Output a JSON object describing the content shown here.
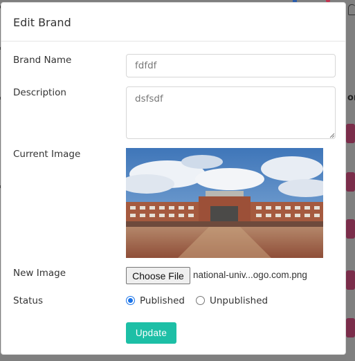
{
  "modal": {
    "title": "Edit Brand"
  },
  "form": {
    "brand_name_label": "Brand Name",
    "brand_name_value": "fdfdf",
    "description_label": "Description",
    "description_value": "dsfsdf",
    "current_image_label": "Current Image",
    "new_image_label": "New Image",
    "choose_file_label": "Choose File",
    "file_name": "national-univ...ogo.com.png",
    "status_label": "Status",
    "status_options": [
      "Published",
      "Unpublished"
    ],
    "status_selected": "Published",
    "submit_label": "Update"
  },
  "background": {
    "column_text": "on"
  },
  "colors": {
    "accent": "#1dbfa6",
    "radio": "#1a73e8",
    "overlay": "#7f7f7f"
  }
}
